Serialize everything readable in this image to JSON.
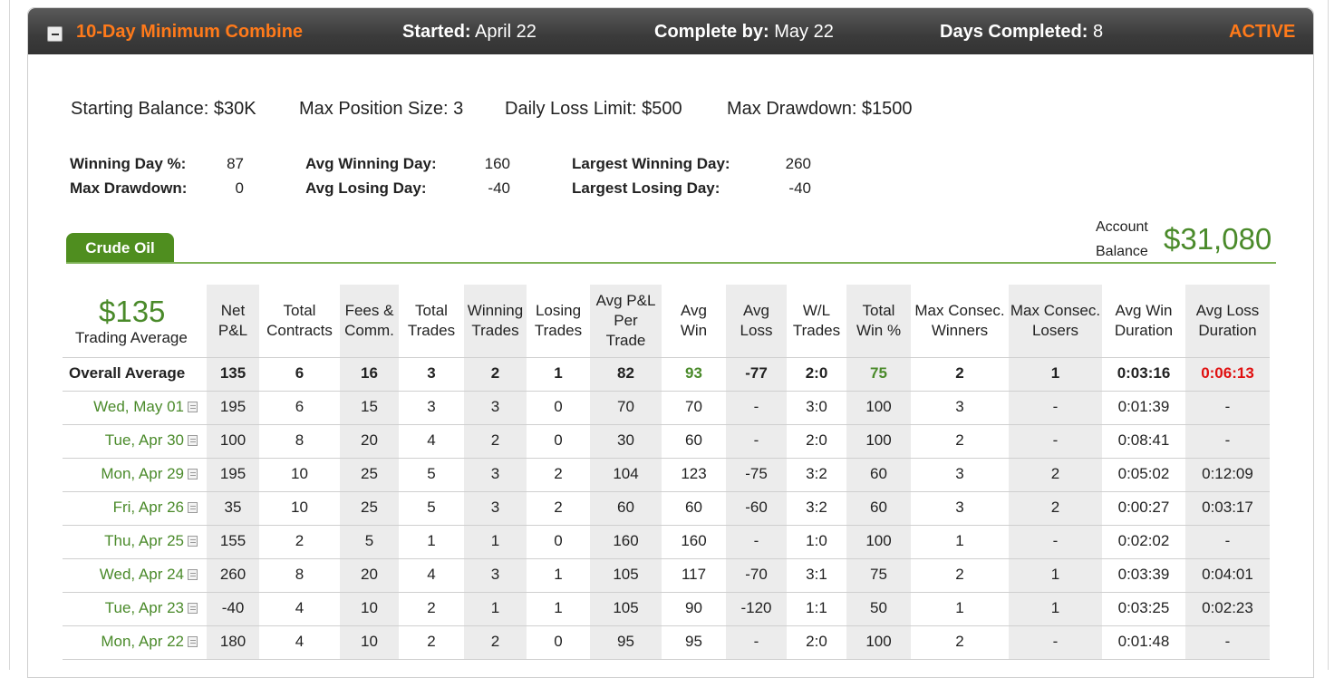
{
  "combine": {
    "title": "10-Day Minimum Combine",
    "started_label": "Started",
    "started_value": "April 22",
    "complete_label": "Complete by",
    "complete_value": "May 22",
    "days_label": "Days Completed",
    "days_value": "8",
    "status": "ACTIVE"
  },
  "rules": {
    "starting_balance": "Starting Balance: $30K",
    "max_position": "Max Position Size: 3",
    "daily_loss": "Daily Loss Limit: $500",
    "max_drawdown": "Max Drawdown: $1500"
  },
  "stats": {
    "winning_day_pct_label": "Winning Day %:",
    "winning_day_pct_value": "87",
    "max_drawdown_label": "Max Drawdown:",
    "max_drawdown_value": "0",
    "avg_winning_day_label": "Avg Winning Day:",
    "avg_winning_day_value": "160",
    "avg_losing_day_label": "Avg Losing Day:",
    "avg_losing_day_value": "-40",
    "largest_winning_day_label": "Largest Winning Day:",
    "largest_winning_day_value": "260",
    "largest_losing_day_label": "Largest Losing Day:",
    "largest_losing_day_value": "-40"
  },
  "tab": {
    "label": "Crude Oil"
  },
  "account": {
    "label_1": "Account",
    "label_2": "Balance",
    "value": "$31,080"
  },
  "trading_average": {
    "value": "$135",
    "label": "Trading Average"
  },
  "table": {
    "headers": [
      [
        "Net",
        "P&L"
      ],
      [
        "Total",
        "Contracts"
      ],
      [
        "Fees &",
        "Comm."
      ],
      [
        "Total",
        "Trades"
      ],
      [
        "Winning",
        "Trades"
      ],
      [
        "Losing",
        "Trades"
      ],
      [
        "Avg P&L",
        "Per",
        "Trade"
      ],
      [
        "Avg",
        "Win"
      ],
      [
        "Avg",
        "Loss"
      ],
      [
        "W/L",
        "Trades"
      ],
      [
        "Total",
        "Win %"
      ],
      [
        "Max Consec.",
        "Winners"
      ],
      [
        "Max Consec.",
        "Losers"
      ],
      [
        "Avg Win",
        "Duration"
      ],
      [
        "Avg Loss",
        "Duration"
      ]
    ],
    "overall": {
      "label": "Overall Average",
      "values": [
        "135",
        "6",
        "16",
        "3",
        "2",
        "1",
        "82",
        "93",
        "-77",
        "2:0",
        "75",
        "2",
        "1",
        "0:03:16",
        "0:06:13"
      ]
    },
    "rows": [
      {
        "date": "Wed, May 01",
        "values": [
          "195",
          "6",
          "15",
          "3",
          "3",
          "0",
          "70",
          "70",
          "-",
          "3:0",
          "100",
          "3",
          "-",
          "0:01:39",
          "-"
        ]
      },
      {
        "date": "Tue, Apr 30",
        "values": [
          "100",
          "8",
          "20",
          "4",
          "2",
          "0",
          "30",
          "60",
          "-",
          "2:0",
          "100",
          "2",
          "-",
          "0:08:41",
          "-"
        ]
      },
      {
        "date": "Mon, Apr 29",
        "values": [
          "195",
          "10",
          "25",
          "5",
          "3",
          "2",
          "104",
          "123",
          "-75",
          "3:2",
          "60",
          "3",
          "2",
          "0:05:02",
          "0:12:09"
        ]
      },
      {
        "date": "Fri, Apr 26",
        "values": [
          "35",
          "10",
          "25",
          "5",
          "3",
          "2",
          "60",
          "60",
          "-60",
          "3:2",
          "60",
          "3",
          "2",
          "0:00:27",
          "0:03:17"
        ]
      },
      {
        "date": "Thu, Apr 25",
        "values": [
          "155",
          "2",
          "5",
          "1",
          "1",
          "0",
          "160",
          "160",
          "-",
          "1:0",
          "100",
          "1",
          "-",
          "0:02:02",
          "-"
        ]
      },
      {
        "date": "Wed, Apr 24",
        "values": [
          "260",
          "8",
          "20",
          "4",
          "3",
          "1",
          "105",
          "117",
          "-70",
          "3:1",
          "75",
          "2",
          "1",
          "0:03:39",
          "0:04:01"
        ]
      },
      {
        "date": "Tue, Apr 23",
        "values": [
          "-40",
          "4",
          "10",
          "2",
          "1",
          "1",
          "105",
          "90",
          "-120",
          "1:1",
          "50",
          "1",
          "1",
          "0:03:25",
          "0:02:23"
        ]
      },
      {
        "date": "Mon, Apr 22",
        "values": [
          "180",
          "4",
          "10",
          "2",
          "2",
          "0",
          "95",
          "95",
          "-",
          "2:0",
          "100",
          "2",
          "-",
          "0:01:48",
          "-"
        ]
      }
    ]
  },
  "colors": {
    "accent_orange": "#ff7a1a",
    "green": "#4a8a2a",
    "tab_green": "#4f8e1f",
    "red": "#e01010"
  },
  "icons": {
    "collapse": "minus-square-icon",
    "note": "note-icon"
  }
}
